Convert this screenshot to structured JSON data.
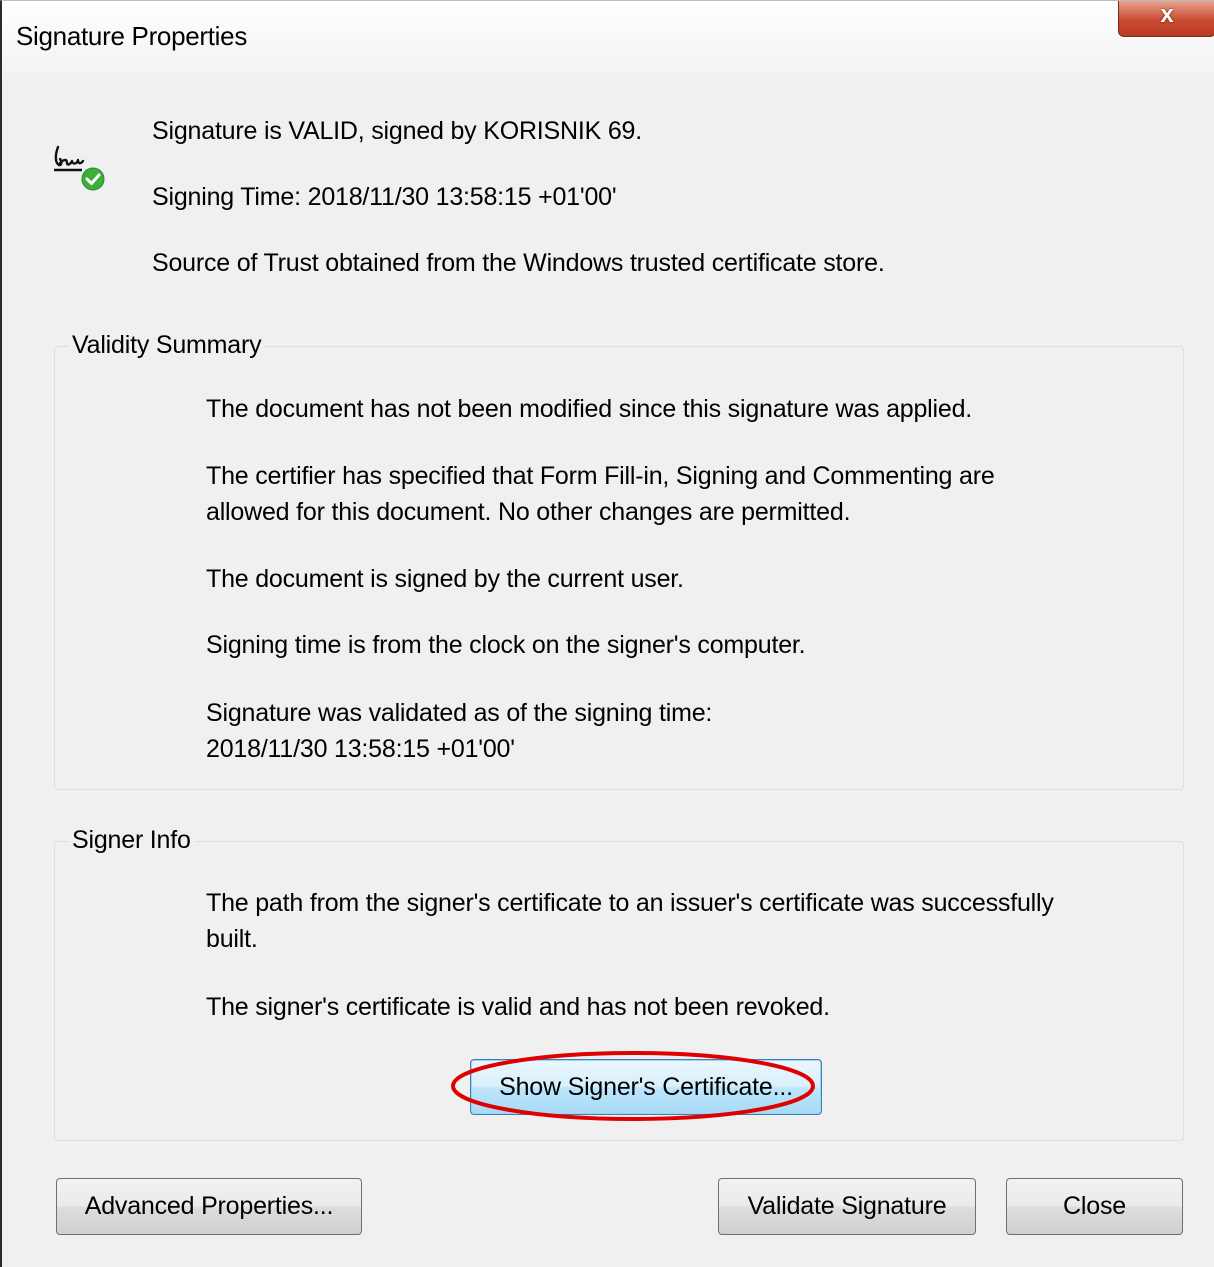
{
  "window": {
    "title": "Signature Properties",
    "close_glyph": "x"
  },
  "header": {
    "icon": "signature-valid-icon",
    "status": "Signature is VALID, signed by KORISNIK 69.",
    "signing_time": "Signing Time:  2018/11/30 13:58:15 +01'00'",
    "trust_source": "Source of Trust obtained from the Windows trusted certificate store."
  },
  "validity_summary": {
    "legend": "Validity Summary",
    "not_modified": "The document has not been modified since this signature was applied.",
    "certifier_line1": "The certifier has specified that Form Fill-in, Signing and Commenting are",
    "certifier_line2": "allowed for this document. No other changes are permitted.",
    "signed_by_current_user": "The document is signed by the current user.",
    "clock_source": "Signing time is from the clock on the signer's computer.",
    "validated_line1": "Signature was validated as of the signing time:",
    "validated_line2": "2018/11/30 13:58:15 +01'00'"
  },
  "signer_info": {
    "legend": "Signer Info",
    "path_line1": "The path from the signer's certificate to an issuer's certificate was successfully",
    "path_line2": "built.",
    "cert_valid": "The signer's certificate is valid and has not been revoked.",
    "show_certificate_label": "Show Signer's Certificate..."
  },
  "buttons": {
    "advanced_properties": "Advanced Properties...",
    "validate_signature": "Validate Signature",
    "close": "Close"
  },
  "colors": {
    "dialog_background": "#f0f0f0",
    "close_button_red": "#c84b32",
    "valid_check_green": "#3cae3c",
    "annotation_red": "#e00000",
    "focused_button_blue": "#3c7fb1"
  }
}
